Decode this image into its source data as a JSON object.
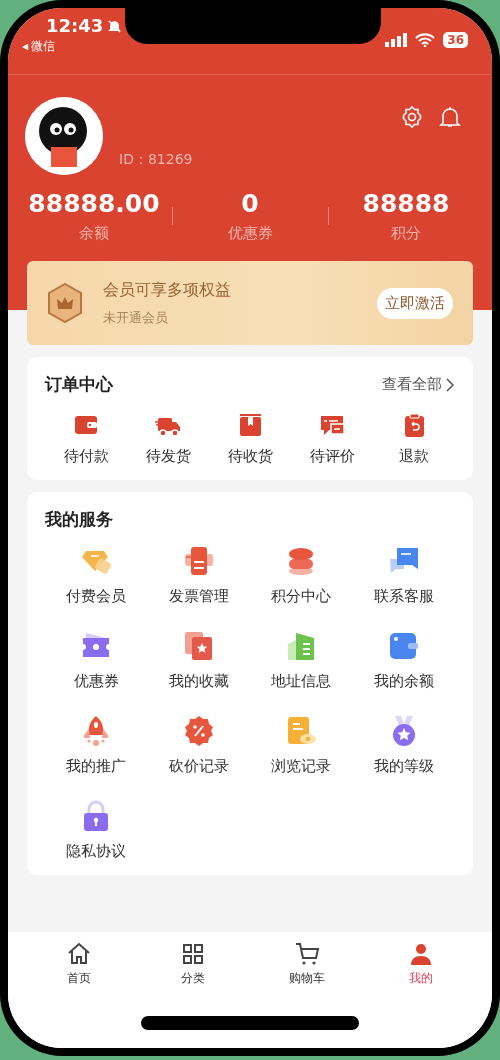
{
  "status_bar": {
    "time": "12:43",
    "back_arrow": "◀",
    "back_app": "微信",
    "battery": "36"
  },
  "profile": {
    "user_id": "ID：81269"
  },
  "stats": [
    {
      "value": "88888.00",
      "label": "余额"
    },
    {
      "value": "0",
      "label": "优惠券"
    },
    {
      "value": "88888",
      "label": "积分"
    }
  ],
  "membership": {
    "title": "会员可享多项权益",
    "subtitle": "未开通会员",
    "button": "立即激活"
  },
  "order_center": {
    "title": "订单中心",
    "view_all": "查看全部",
    "items": [
      {
        "label": "待付款"
      },
      {
        "label": "待发货"
      },
      {
        "label": "待收货"
      },
      {
        "label": "待评价"
      },
      {
        "label": "退款"
      }
    ]
  },
  "services": {
    "title": "我的服务",
    "items": [
      {
        "label": "付费会员"
      },
      {
        "label": "发票管理"
      },
      {
        "label": "积分中心"
      },
      {
        "label": "联系客服"
      },
      {
        "label": "优惠券"
      },
      {
        "label": "我的收藏"
      },
      {
        "label": "地址信息"
      },
      {
        "label": "我的余额"
      },
      {
        "label": "我的推广"
      },
      {
        "label": "砍价记录"
      },
      {
        "label": "浏览记录"
      },
      {
        "label": "我的等级"
      },
      {
        "label": "隐私协议"
      }
    ]
  },
  "tab_bar": [
    {
      "label": "首页",
      "selected": false
    },
    {
      "label": "分类",
      "selected": false
    },
    {
      "label": "购物车",
      "selected": false
    },
    {
      "label": "我的",
      "selected": true
    }
  ]
}
